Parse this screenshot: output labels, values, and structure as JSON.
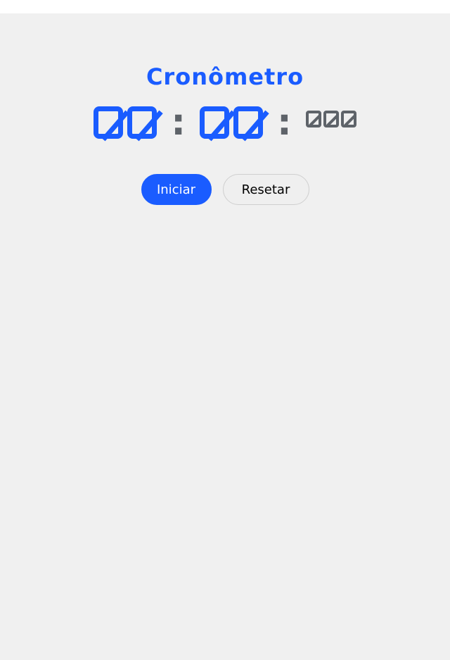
{
  "app": {
    "title": "Cronômetro"
  },
  "timer": {
    "minutes": "00",
    "seconds": "00",
    "milliseconds": "000",
    "separator": ":"
  },
  "buttons": {
    "start_label": "Iniciar",
    "reset_label": "Resetar"
  },
  "colors": {
    "accent": "#1a5cff",
    "digits_secondary": "#5e6369",
    "background": "#f0f0f0"
  }
}
